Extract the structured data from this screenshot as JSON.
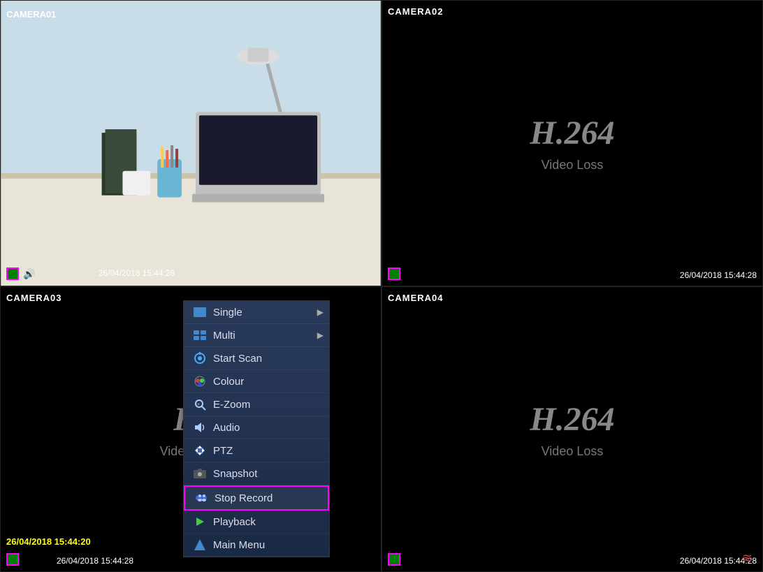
{
  "cameras": [
    {
      "id": "cam1",
      "label": "CAMERA01",
      "timestamp": "26/04/2018 15:44:28",
      "hasVideo": true,
      "hasAudio": true
    },
    {
      "id": "cam2",
      "label": "CAMERA02",
      "timestamp": "26/04/2018 15:44:28",
      "hasVideo": false,
      "codec": "H.264",
      "lossText": "Video Loss"
    },
    {
      "id": "cam3",
      "label": "CAMERA03",
      "timestamp": "26/04/2018 15:44:28",
      "timestampYellow": "26/04/2018 15:44:20",
      "hasVideo": false,
      "codec": "H.",
      "lossText": "Video Loss"
    },
    {
      "id": "cam4",
      "label": "CAMERA04",
      "timestamp": "26/04/2018 15:44:28",
      "hasVideo": false,
      "codec": "H.264",
      "lossText": "Video Loss"
    }
  ],
  "contextMenu": {
    "items": [
      {
        "label": "Single",
        "hasArrow": true,
        "icon": "single"
      },
      {
        "label": "Multi",
        "hasArrow": true,
        "icon": "multi"
      },
      {
        "label": "Start Scan",
        "hasArrow": false,
        "icon": "scan"
      },
      {
        "label": "Colour",
        "hasArrow": false,
        "icon": "colour"
      },
      {
        "label": "E-Zoom",
        "hasArrow": false,
        "icon": "zoom"
      },
      {
        "label": "Audio",
        "hasArrow": false,
        "icon": "audio"
      },
      {
        "label": "PTZ",
        "hasArrow": false,
        "icon": "ptz"
      },
      {
        "label": "Snapshot",
        "hasArrow": false,
        "icon": "snapshot"
      },
      {
        "label": "Stop Record",
        "hasArrow": false,
        "icon": "record",
        "highlighted": true
      },
      {
        "label": "Playback",
        "hasArrow": false,
        "icon": "playback"
      },
      {
        "label": "Main Menu",
        "hasArrow": false,
        "icon": "mainmenu"
      }
    ]
  }
}
